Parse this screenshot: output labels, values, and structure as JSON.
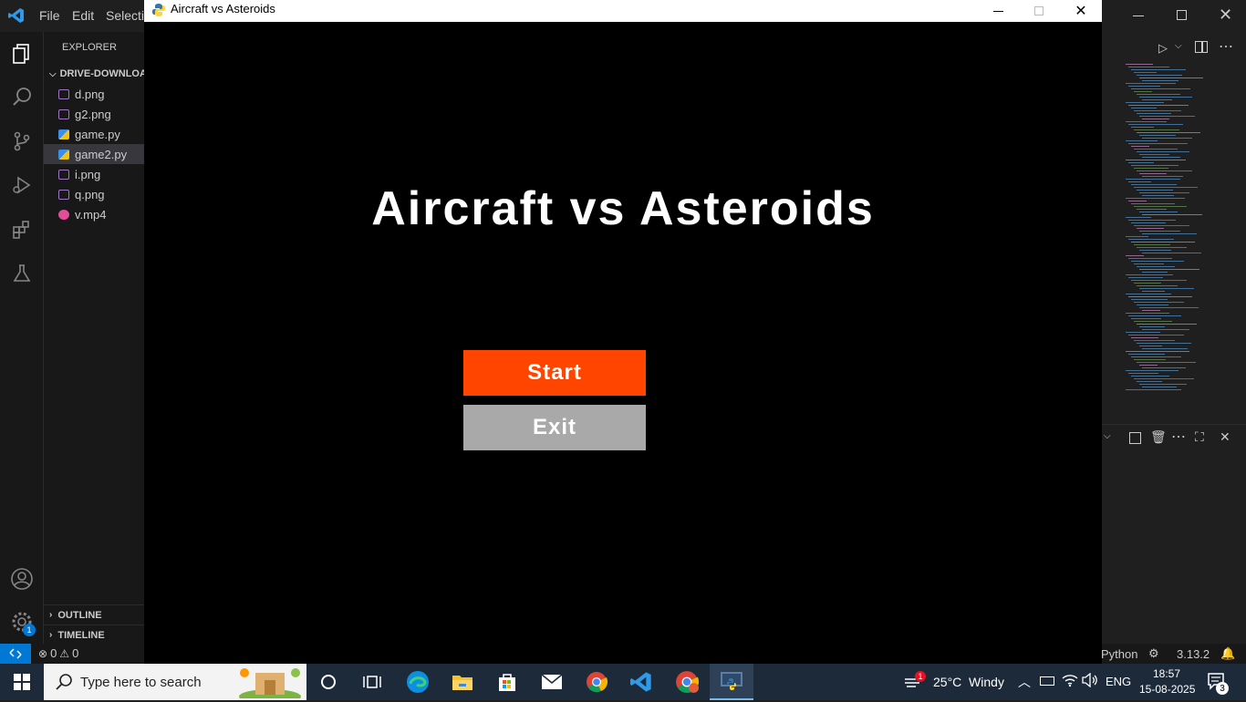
{
  "vscode": {
    "menu": [
      "File",
      "Edit",
      "Selectio"
    ],
    "explorer_title": "EXPLORER",
    "folder_name": "DRIVE-DOWNLOA",
    "files": [
      {
        "name": "d.png",
        "type": "image"
      },
      {
        "name": "g2.png",
        "type": "image"
      },
      {
        "name": "game.py",
        "type": "python"
      },
      {
        "name": "game2.py",
        "type": "python",
        "selected": true
      },
      {
        "name": "i.png",
        "type": "image"
      },
      {
        "name": "q.png",
        "type": "image"
      },
      {
        "name": "v.mp4",
        "type": "video"
      }
    ],
    "outline_label": "OUTLINE",
    "timeline_label": "TIMELINE",
    "settings_badge": "1",
    "status": {
      "errors": "0",
      "warnings": "0",
      "language": "Python",
      "python_version": "3.13.2"
    }
  },
  "game": {
    "window_title": "Aircraft vs Asteroids",
    "heading": "Aircraft vs Asteroids",
    "start_label": "Start",
    "exit_label": "Exit",
    "colors": {
      "start": "#ff4500",
      "exit": "#a9a9a9",
      "background": "#000000"
    }
  },
  "taskbar": {
    "search_placeholder": "Type here to search",
    "weather_badge": "1",
    "weather": "25°C  Windy",
    "language": "ENG",
    "time": "18:57",
    "date": "15-08-2025",
    "notifications": "3"
  }
}
